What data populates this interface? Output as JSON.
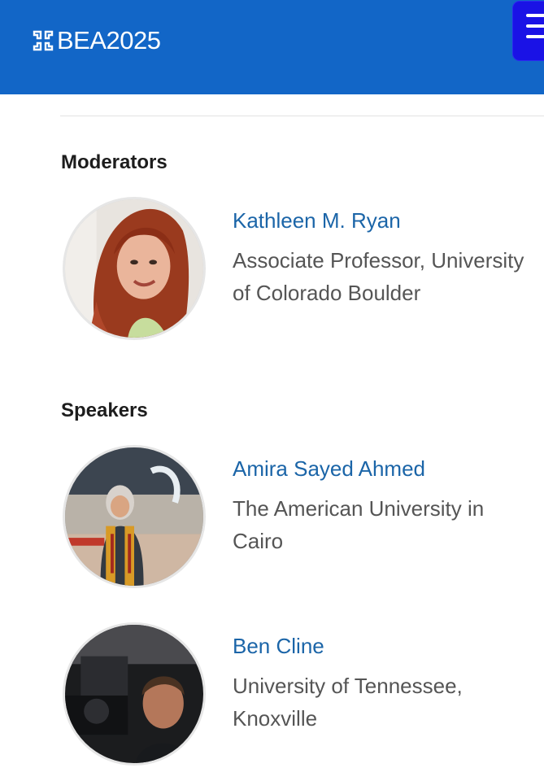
{
  "header": {
    "brand": "BEA2025",
    "logo_icon": "bea-logo-mark",
    "menu_icon": "hamburger-menu-icon",
    "background_color": "#1266c7",
    "menu_button_color": "#1a12e6"
  },
  "sections": {
    "moderators": {
      "title": "Moderators",
      "people": [
        {
          "name": "Kathleen M. Ryan",
          "affiliation": "Associate Professor, University of Colorado Boulder"
        }
      ]
    },
    "speakers": {
      "title": "Speakers",
      "people": [
        {
          "name": "Amira Sayed Ahmed",
          "affiliation": "The American University in Cairo"
        },
        {
          "name": "Ben Cline",
          "affiliation": "University of Tennessee, Knoxville"
        }
      ]
    }
  },
  "colors": {
    "name_link": "#1b65a8",
    "affiliation_text": "#555555",
    "section_title": "#1d1d1d"
  }
}
